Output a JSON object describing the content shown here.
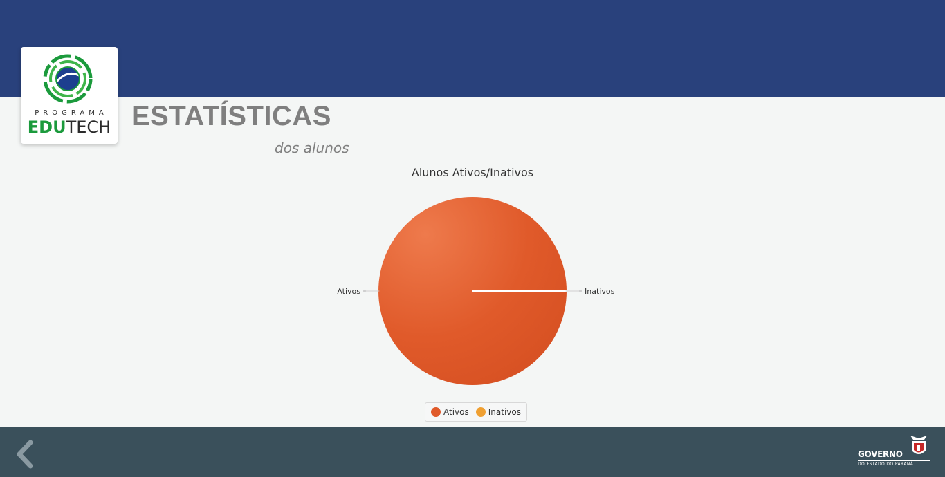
{
  "header": {
    "logo": {
      "programa": "PROGRAMA",
      "name_bold": "EDU",
      "name_light": "TECH"
    },
    "title": "ESTATÍSTICAS",
    "subtitle": "dos alunos"
  },
  "chart_data": {
    "type": "pie",
    "title": "Alunos Ativos/Inativos",
    "categories": [
      "Ativos",
      "Inativos"
    ],
    "values": [
      100,
      0
    ],
    "colors": [
      "#e05a2a",
      "#f0a032"
    ],
    "legend": "bottom-center"
  },
  "footer": {
    "back_icon": "chevron-left-icon",
    "gov_logo": {
      "line1": "GOVERNO",
      "line2": "DO ESTADO DO PARANÁ"
    }
  },
  "colors": {
    "header_band": "#29417c",
    "footer_band": "#3a505b",
    "background": "#f4f6f5",
    "title_text": "#7f7f7f",
    "logo_green": "#1b9a3c"
  }
}
